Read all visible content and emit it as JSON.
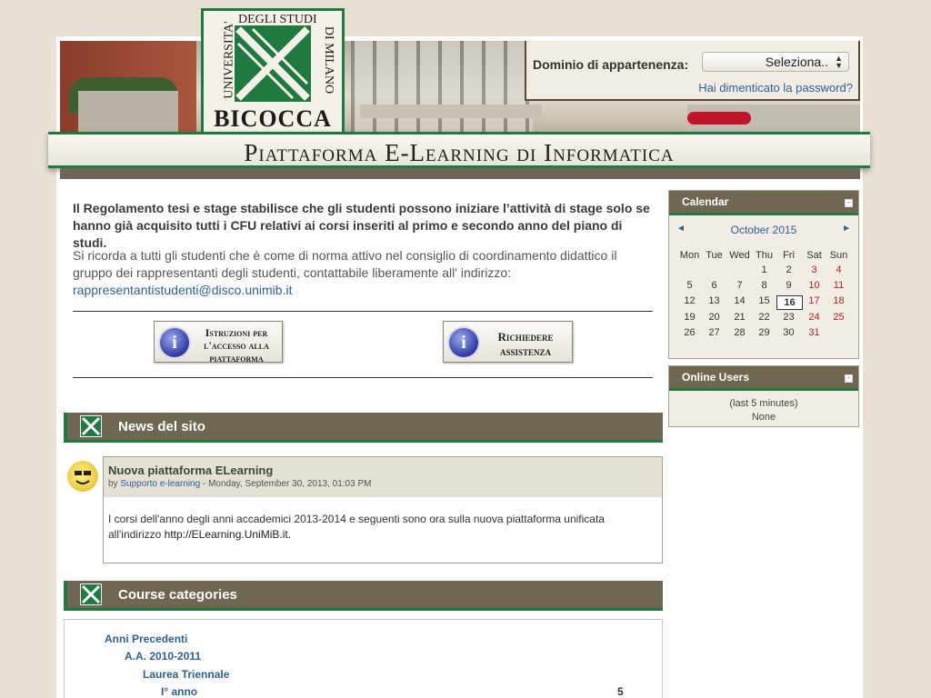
{
  "header": {
    "logo": {
      "top": "DEGLI STUDI",
      "left": "UNIVERSITA'",
      "right": "DI MILANO",
      "name": "BICOCCA"
    },
    "login": {
      "domain_label": "Dominio di appartenenza:",
      "domain_value": "Seleziona..",
      "forgot_password": "Hai dimenticato la password?"
    },
    "site_title": "Piattaforma E-Learning di Informatica"
  },
  "main": {
    "intro_bold": "Il Regolamento tesi e stage stabilisce che gli studenti possono iniziare l’attività di stage solo se hanno già acquisito tutti i CFU relativi ai corsi inseriti al primo e secondo anno del piano di studi.",
    "intro_text": "Si ricorda a tutti gli studenti che è come di norma attivo nel consiglio di coordinamento didattico il gruppo dei rappresentanti degli studenti, contattabile liberamente all' indirizzo:",
    "intro_email": "rappresentantistudenti@disco.unimib.it",
    "buttons": {
      "access_line1": "Istruzioni per",
      "access_line2": "l'accesso alla",
      "access_line3": "piattaforma",
      "help_line1": "Richiedere",
      "help_line2": "assistenza"
    },
    "news": {
      "title": "News del sito",
      "post_title": "Nuova piattaforma ELearning",
      "post_by": "by",
      "post_author": "Supporto e-learning",
      "post_date": " - Monday, September 30, 2013, 01:03 PM",
      "post_body": "I corsi dell'anno degli anni accademici 2013-2014 e seguenti sono ora sulla nuova piattaforma unificata all'indirizzo",
      "post_link": "http://ELearning.UniMiB.it."
    },
    "categories": {
      "title": "Course categories",
      "items": [
        "Anni Precedenti",
        "A.A. 2010-2011",
        "Laurea Triennale",
        "I° anno"
      ],
      "count": "5"
    }
  },
  "calendar": {
    "title": "Calendar",
    "month": "October 2015",
    "prev": "◄",
    "next": "►",
    "weekdays": [
      "Mon",
      "Tue",
      "Wed",
      "Thu",
      "Fri",
      "Sat",
      "Sun"
    ],
    "weeks": [
      [
        "",
        "",
        "",
        "1",
        "2",
        "3",
        "4"
      ],
      [
        "5",
        "6",
        "7",
        "8",
        "9",
        "10",
        "11"
      ],
      [
        "12",
        "13",
        "14",
        "15",
        "16",
        "17",
        "18"
      ],
      [
        "19",
        "20",
        "21",
        "22",
        "23",
        "24",
        "25"
      ],
      [
        "26",
        "27",
        "28",
        "29",
        "30",
        "31",
        ""
      ]
    ],
    "today": "16",
    "weekend_color": "#b71c1c"
  },
  "online_users": {
    "title": "Online Users",
    "period": "(last 5 minutes)",
    "none": "None"
  },
  "colors": {
    "accent_green": "#1e7a3f",
    "header_brown": "#6f6752",
    "link_blue": "#2f5f93"
  }
}
